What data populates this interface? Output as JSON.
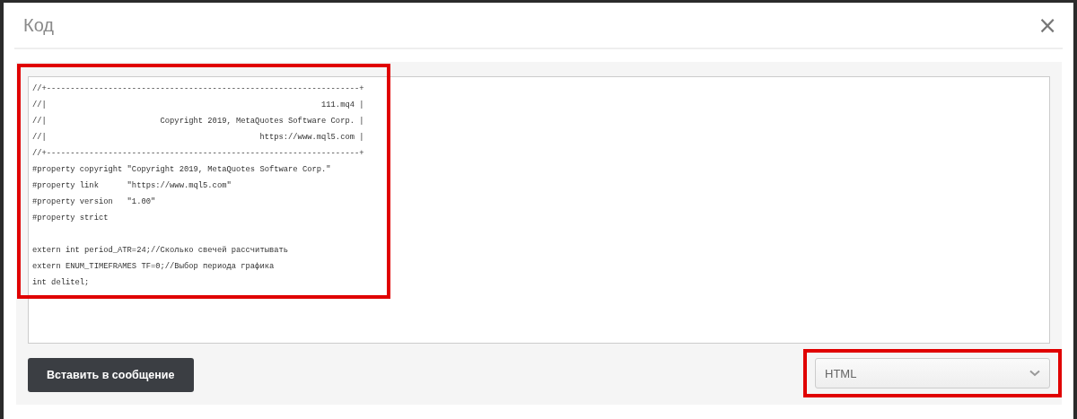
{
  "dialog": {
    "title": "Код",
    "close": "×"
  },
  "code_editor": {
    "value": "//+------------------------------------------------------------------+\n//|                                                          111.mq4 |\n//|                        Copyright 2019, MetaQuotes Software Corp. |\n//|                                             https://www.mql5.com |\n//+------------------------------------------------------------------+\n#property copyright \"Copyright 2019, MetaQuotes Software Corp.\"\n#property link      \"https://www.mql5.com\"\n#property version   \"1.00\"\n#property strict\n\nextern int period_ATR=24;//Сколько свечей рассчитывать\nextern ENUM_TIMEFRAMES TF=0;//Выбор периода графика\nint delitel;",
    "highlighted": true
  },
  "insert_button": {
    "label": "Вставить в сообщение"
  },
  "language_select": {
    "value": "HTML",
    "highlighted": true
  }
}
